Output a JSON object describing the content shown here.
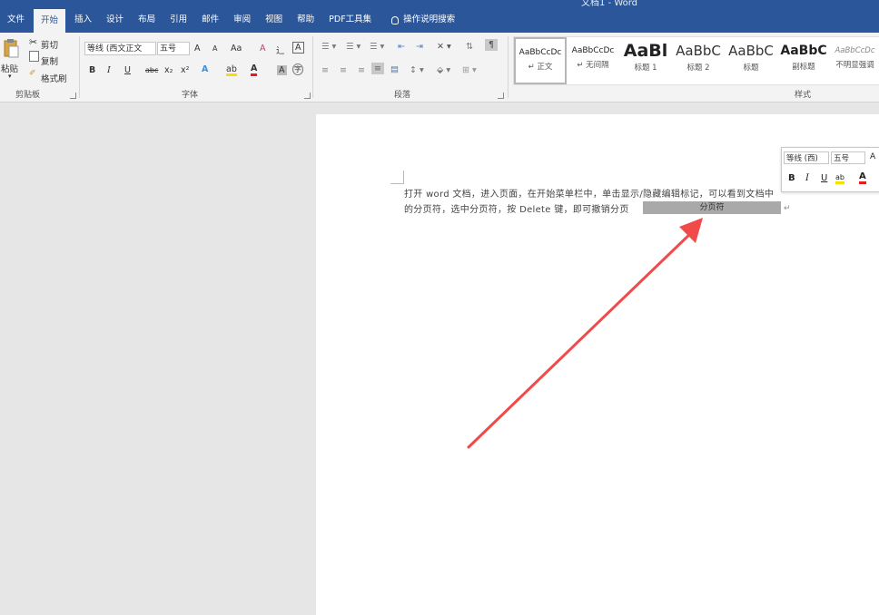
{
  "window": {
    "title": "文档1 - Word"
  },
  "tabs": [
    {
      "label": "文件"
    },
    {
      "label": "开始"
    },
    {
      "label": "插入"
    },
    {
      "label": "设计"
    },
    {
      "label": "布局"
    },
    {
      "label": "引用"
    },
    {
      "label": "邮件"
    },
    {
      "label": "审阅"
    },
    {
      "label": "视图"
    },
    {
      "label": "帮助"
    },
    {
      "label": "PDF工具集"
    }
  ],
  "search": {
    "label": "操作说明搜索"
  },
  "clipboard": {
    "paste": "粘贴",
    "cut": "剪切",
    "copy": "复制",
    "format_painter": "格式刷",
    "group": "剪贴板"
  },
  "font": {
    "name": "等线 (西文正文",
    "size": "五号",
    "grow": "A",
    "shrink": "A",
    "change_case": "Aa",
    "clear": "A",
    "bold": "B",
    "italic": "I",
    "underline": "U",
    "strike": "abc",
    "subscript": "x₂",
    "superscript": "x²",
    "text_effect": "A",
    "highlight": "ab",
    "font_color": "A",
    "char_shading": "A",
    "enclose": "字",
    "group": "字体"
  },
  "paragraph": {
    "group": "段落"
  },
  "styles": {
    "group": "样式",
    "items": [
      {
        "sample": "AaBbCcDc",
        "name": "↵ 正文"
      },
      {
        "sample": "AaBbCcDc",
        "name": "↵ 无间隔"
      },
      {
        "sample": "AaBl",
        "name": "标题 1"
      },
      {
        "sample": "AaBbC",
        "name": "标题 2"
      },
      {
        "sample": "AaBbC",
        "name": "标题"
      },
      {
        "sample": "AaBbC",
        "name": "副标题"
      },
      {
        "sample": "AaBbCcDc",
        "name": "不明显强调"
      }
    ]
  },
  "document": {
    "line1": "打开 word 文档，进入页面，在开始菜单栏中，单击显示/隐藏编辑标记，可以看到文档中",
    "line2": "的分页符，选中分页符，按 Delete 键，即可撤销分页",
    "page_break": "分页符"
  },
  "mini_toolbar": {
    "font": "等线 (西)",
    "size": "五号",
    "grow": "A",
    "bold": "B",
    "italic": "I",
    "underline": "U",
    "highlight": "ab",
    "font_color": "A"
  },
  "colors": {
    "accent": "#2b579a",
    "arrow": "#f04a4a",
    "page_break_bg": "#a9a9a9"
  }
}
